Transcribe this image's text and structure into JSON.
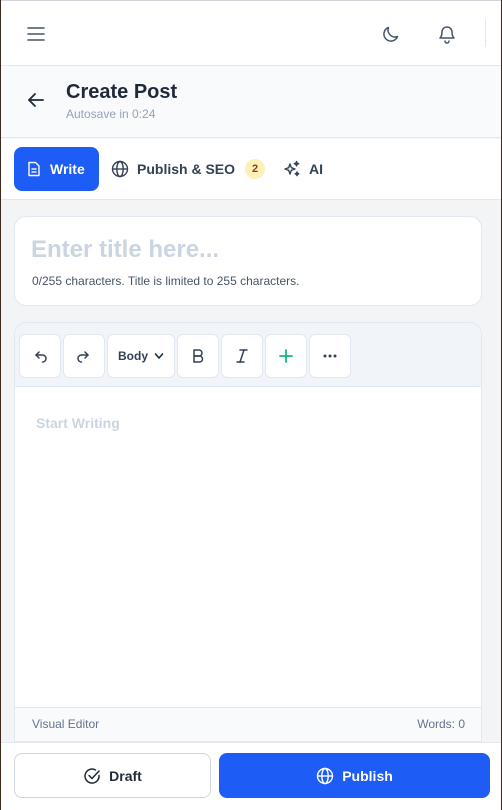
{
  "topbar": {
    "icons": [
      "menu-icon",
      "moon-icon",
      "bell-icon"
    ]
  },
  "header": {
    "title": "Create Post",
    "autosave": "Autosave in 0:24"
  },
  "tabs": [
    {
      "label": "Write",
      "icon": "document-icon",
      "active": true
    },
    {
      "label": "Publish & SEO",
      "icon": "globe-icon",
      "badge": "2"
    },
    {
      "label": "AI",
      "icon": "sparkles-icon"
    }
  ],
  "title_field": {
    "value": "",
    "placeholder": "Enter title here...",
    "hint": "0/255 characters. Title is limited to 255 characters."
  },
  "editor": {
    "format_select": "Body",
    "format_options": [
      "Body"
    ],
    "placeholder": "Start Writing",
    "mode": "Visual Editor",
    "word_count": "Words: 0"
  },
  "actions": {
    "draft_label": "Draft",
    "publish_label": "Publish"
  },
  "colors": {
    "accent": "#1d5cf5",
    "badge_bg": "#fdf0b8",
    "insert_icon": "#10b981"
  }
}
